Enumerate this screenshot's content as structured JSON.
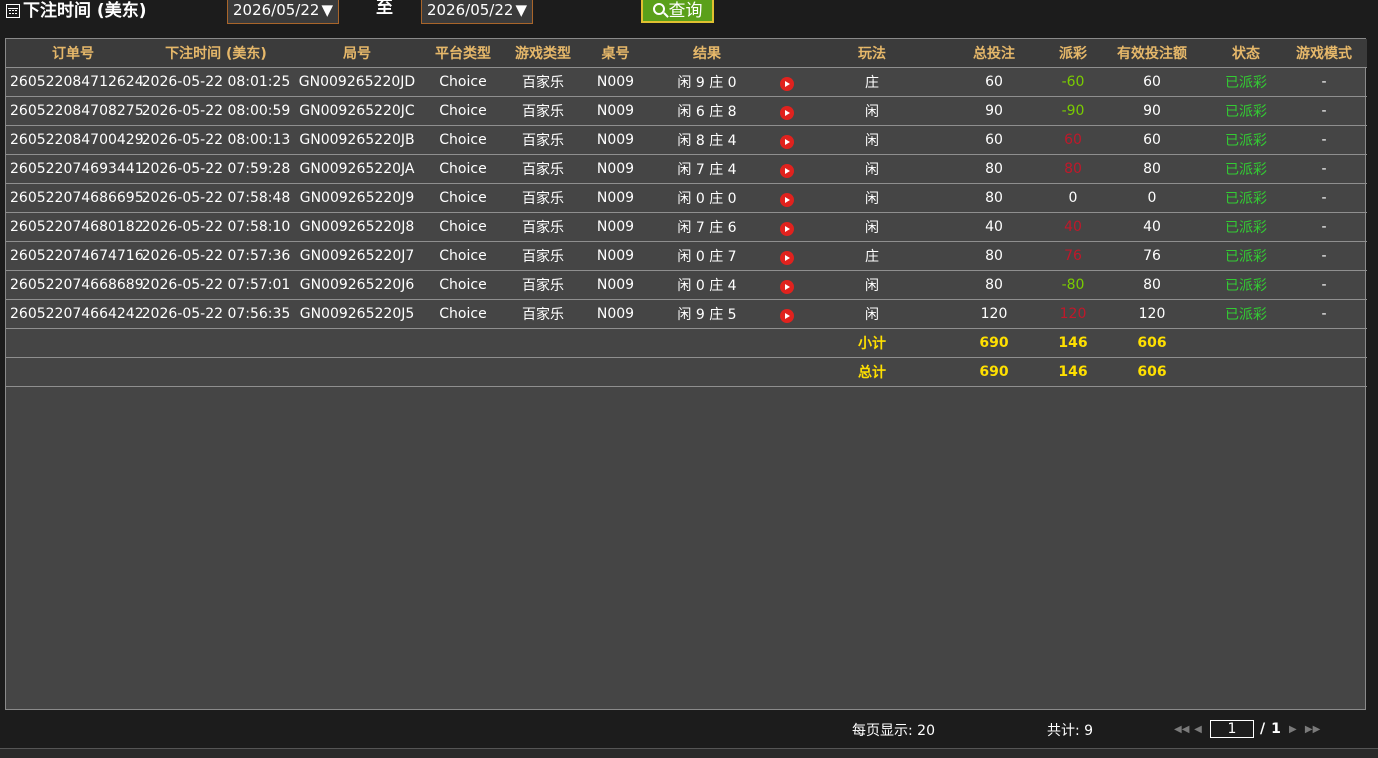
{
  "filter": {
    "label": "下注时间 (美东)",
    "start_date": "2026/05/22",
    "to_label": "至",
    "end_date": "2026/05/22",
    "query_label": "查询"
  },
  "table": {
    "headers": [
      "订单号",
      "下注时间 (美东)",
      "局号",
      "平台类型",
      "游戏类型",
      "桌号",
      "结果",
      "",
      "玩法",
      "总投注",
      "派彩",
      "有效投注额",
      "状态",
      "游戏模式"
    ],
    "rows": [
      {
        "order": "260522084712624",
        "time": "2026-05-22 08:01:25",
        "round": "GN009265220JD",
        "platform": "Choice",
        "game": "百家乐",
        "table": "N009",
        "result": "闲 9 庄 0",
        "play": "庄",
        "bet": "60",
        "payout": "-60",
        "valid": "60",
        "status": "已派彩",
        "mode": "-"
      },
      {
        "order": "260522084708275",
        "time": "2026-05-22 08:00:59",
        "round": "GN009265220JC",
        "platform": "Choice",
        "game": "百家乐",
        "table": "N009",
        "result": "闲 6 庄 8",
        "play": "闲",
        "bet": "90",
        "payout": "-90",
        "valid": "90",
        "status": "已派彩",
        "mode": "-"
      },
      {
        "order": "260522084700429",
        "time": "2026-05-22 08:00:13",
        "round": "GN009265220JB",
        "platform": "Choice",
        "game": "百家乐",
        "table": "N009",
        "result": "闲 8 庄 4",
        "play": "闲",
        "bet": "60",
        "payout": "60",
        "valid": "60",
        "status": "已派彩",
        "mode": "-"
      },
      {
        "order": "260522074693441",
        "time": "2026-05-22 07:59:28",
        "round": "GN009265220JA",
        "platform": "Choice",
        "game": "百家乐",
        "table": "N009",
        "result": "闲 7 庄 4",
        "play": "闲",
        "bet": "80",
        "payout": "80",
        "valid": "80",
        "status": "已派彩",
        "mode": "-"
      },
      {
        "order": "260522074686695",
        "time": "2026-05-22 07:58:48",
        "round": "GN009265220J9",
        "platform": "Choice",
        "game": "百家乐",
        "table": "N009",
        "result": "闲 0 庄 0",
        "play": "闲",
        "bet": "80",
        "payout": "0",
        "valid": "0",
        "status": "已派彩",
        "mode": "-"
      },
      {
        "order": "260522074680182",
        "time": "2026-05-22 07:58:10",
        "round": "GN009265220J8",
        "platform": "Choice",
        "game": "百家乐",
        "table": "N009",
        "result": "闲 7 庄 6",
        "play": "闲",
        "bet": "40",
        "payout": "40",
        "valid": "40",
        "status": "已派彩",
        "mode": "-"
      },
      {
        "order": "260522074674716",
        "time": "2026-05-22 07:57:36",
        "round": "GN009265220J7",
        "platform": "Choice",
        "game": "百家乐",
        "table": "N009",
        "result": "闲 0 庄 7",
        "play": "庄",
        "bet": "80",
        "payout": "76",
        "valid": "76",
        "status": "已派彩",
        "mode": "-"
      },
      {
        "order": "260522074668689",
        "time": "2026-05-22 07:57:01",
        "round": "GN009265220J6",
        "platform": "Choice",
        "game": "百家乐",
        "table": "N009",
        "result": "闲 0 庄 4",
        "play": "闲",
        "bet": "80",
        "payout": "-80",
        "valid": "80",
        "status": "已派彩",
        "mode": "-"
      },
      {
        "order": "260522074664242",
        "time": "2026-05-22 07:56:35",
        "round": "GN009265220J5",
        "platform": "Choice",
        "game": "百家乐",
        "table": "N009",
        "result": "闲 9 庄 5",
        "play": "闲",
        "bet": "120",
        "payout": "120",
        "valid": "120",
        "status": "已派彩",
        "mode": "-"
      }
    ],
    "subtotal": {
      "label": "小计",
      "bet": "690",
      "payout": "146",
      "valid": "606"
    },
    "total": {
      "label": "总计",
      "bet": "690",
      "payout": "146",
      "valid": "606"
    }
  },
  "footer": {
    "per_page": "每页显示: 20",
    "total_count": "共计: 9",
    "current_page": "1",
    "slash": "/",
    "total_pages": "1"
  },
  "colors": {
    "header_text": "#e6b86a",
    "payout_negative": "#7acc00",
    "payout_positive": "#c0182a",
    "status": "#33cc33",
    "totals": "#ffe000",
    "query_button": "#5aa01a"
  },
  "icons": {
    "filter": "calendar-icon",
    "query": "search-icon",
    "video": "play-icon",
    "select": "triangle-down-icon"
  }
}
